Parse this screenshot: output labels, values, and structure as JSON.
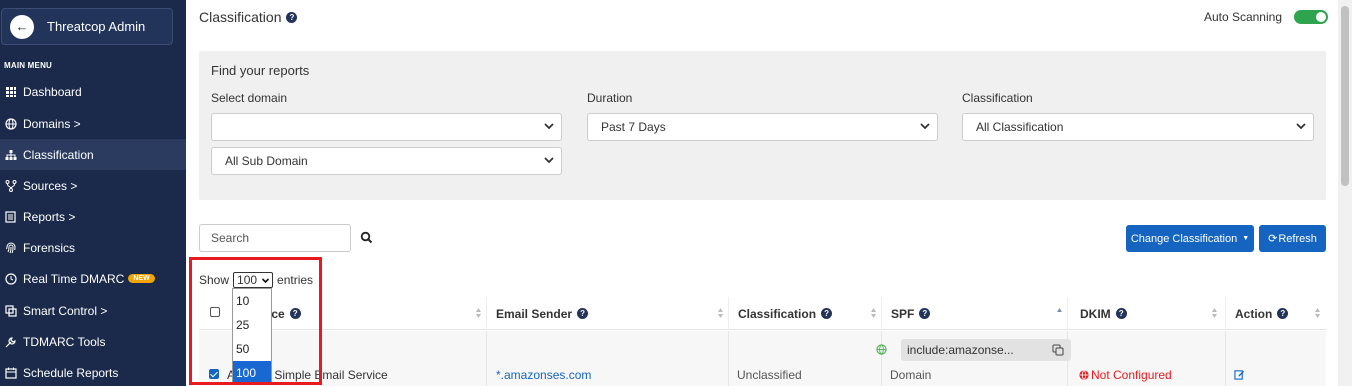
{
  "sidebar": {
    "brand": "Threatcop Admin",
    "menu_title": "MAIN MENU",
    "items": [
      {
        "label": "Dashboard"
      },
      {
        "label": "Domains >"
      },
      {
        "label": "Classification"
      },
      {
        "label": "Sources >"
      },
      {
        "label": "Reports >"
      },
      {
        "label": "Forensics"
      },
      {
        "label": "Real Time DMARC",
        "badge": "NEW"
      },
      {
        "label": "Smart Control >"
      },
      {
        "label": "TDMARC Tools"
      },
      {
        "label": "Schedule Reports"
      }
    ]
  },
  "header": {
    "title": "Classification",
    "auto_scanning_label": "Auto Scanning",
    "auto_scanning_on": true
  },
  "filters": {
    "title": "Find your reports",
    "domain_label": "Select domain",
    "domain_value": "",
    "subdomain_value": "All Sub Domain",
    "duration_label": "Duration",
    "duration_value": "Past 7 Days",
    "classification_label": "Classification",
    "classification_value": "All Classification"
  },
  "toolbar": {
    "search_placeholder": "Search",
    "change_classification": "Change Classification",
    "refresh": "Refresh"
  },
  "entries": {
    "show_label": "Show",
    "entries_label": "entries",
    "selected": "100",
    "options": [
      "10",
      "25",
      "50",
      "100"
    ]
  },
  "table": {
    "columns": {
      "source": "Source",
      "email_sender": "Email Sender",
      "classification": "Classification",
      "spf": "SPF",
      "dkim": "DKIM",
      "action": "Action"
    },
    "rows": [
      {
        "source": "Amazon Simple Email Service",
        "email_sender": "*.amazonses.com",
        "classification": "Unclassified",
        "spf_include": "include:amazonse...",
        "spf_type": "Domain",
        "dkim": "Not Configured"
      }
    ]
  },
  "colors": {
    "sidebar_bg": "#1b2a4a",
    "accent": "#1565c0",
    "toggle_on": "#2ea44f",
    "error": "#e8191f"
  }
}
